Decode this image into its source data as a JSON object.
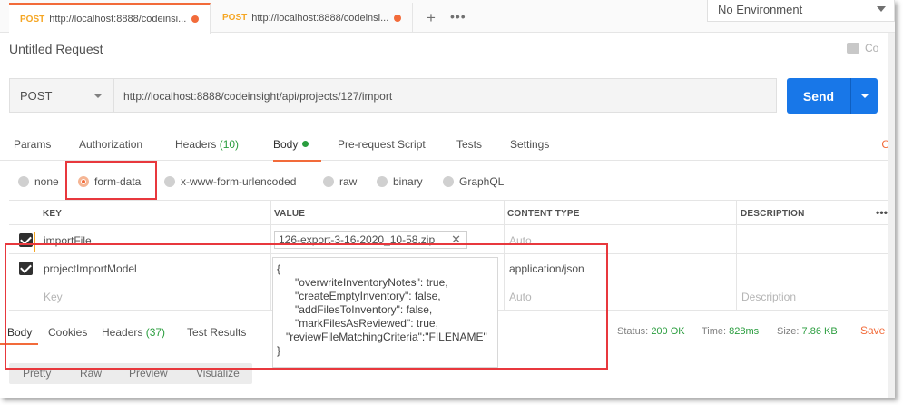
{
  "tabs": [
    {
      "method": "POST",
      "url": "http://localhost:8888/codeinsi..."
    },
    {
      "method": "POST",
      "url": "http://localhost:8888/codeinsi..."
    }
  ],
  "tab_add": "+",
  "tab_more": "•••",
  "environment": "No Environment",
  "request_title": "Untitled Request",
  "comments_label": "Co",
  "method": "POST",
  "url": "http://localhost:8888/codeinsight/api/projects/127/import",
  "send_label": "Send",
  "request_tabs": {
    "params": "Params",
    "authorization": "Authorization",
    "headers": "Headers",
    "headers_count": "(10)",
    "body": "Body",
    "prerequest": "Pre-request Script",
    "tests": "Tests",
    "settings": "Settings"
  },
  "body_types": [
    "none",
    "form-data",
    "x-www-form-urlencoded",
    "raw",
    "binary",
    "GraphQL"
  ],
  "table": {
    "headers": [
      "KEY",
      "VALUE",
      "CONTENT TYPE",
      "DESCRIPTION"
    ],
    "more": "•••",
    "rows": [
      {
        "key": "importFile",
        "value": "126-export-3-16-2020_10-58.zip",
        "content_type": "Auto"
      },
      {
        "key": "projectImportModel",
        "content_type": "application/json"
      }
    ],
    "placeholder": {
      "key": "Key",
      "content_type": "Auto",
      "description": "Description"
    }
  },
  "json_value": "{\n      \"overwriteInventoryNotes\": true,\n      \"createEmptyInventory\": false,\n      \"addFilesToInventory\": false,\n      \"markFilesAsReviewed\": true,\n   \"reviewFileMatchingCriteria\":\"FILENAME\"\n}",
  "response_tabs": {
    "body": "Body",
    "cookies": "Cookies",
    "headers": "Headers",
    "headers_count": "(37)",
    "test_results": "Test Results"
  },
  "response_status": {
    "status_label": "Status:",
    "status": "200 OK",
    "time_label": "Time:",
    "time": "828ms",
    "size_label": "Size:",
    "size": "7.86 KB"
  },
  "save_label": "Save",
  "view_options": [
    "Pretty",
    "Raw",
    "Preview",
    "Visualize"
  ],
  "colors": {
    "accent": "#f26b3a",
    "send": "#1877e8",
    "highlight": "#e8383d",
    "success": "#2a9d3e"
  }
}
